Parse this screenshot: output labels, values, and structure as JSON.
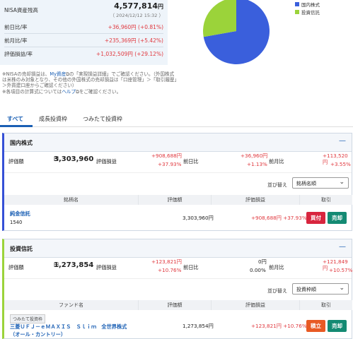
{
  "summary": {
    "nisa_label": "NISA資産残高",
    "nisa_value": "4,577,814",
    "nisa_unit": "円",
    "nisa_time": "（ 2024/12/12 15:32 ）",
    "rows": [
      {
        "label": "前日比/率",
        "value": "+36,960円 (+0.81%)"
      },
      {
        "label": "前月比/率",
        "value": "+235,369円 (+5.42%)"
      },
      {
        "label": "評価損益/率",
        "value": "+1,032,509円 (+29.12%)"
      }
    ]
  },
  "chart_data": {
    "type": "pie",
    "categories": [
      "国内株式",
      "投資信託"
    ],
    "values": [
      3303960,
      1273854
    ],
    "colors": [
      "#3a5fdc",
      "#9bd33a"
    ]
  },
  "notes": [
    "※NISAの売却損益は、",
    "My資産",
    "の「実現損益詳細」でご確認ください。",
    "（外国株式は米株のみ対象となり、その他の外国株式の売却損益は「口座管理」＞「取引履歴」＞外貨建口座からご確認ください）",
    "※各項目の計算式については",
    "ヘルプ",
    "をご確認ください。"
  ],
  "tabs": [
    "すべて",
    "成長投資枠",
    "つみたて投資枠"
  ],
  "domestic": {
    "title": "国内株式",
    "valuation_label": "評価額",
    "valuation": "3,303,960",
    "unit": "円",
    "pl_label": "評価損益",
    "pl_amount": "+908,688円",
    "pl_rate": "+37.93%",
    "day_label": "前日比",
    "day_amount": "+36,960円",
    "day_rate": "+1.13%",
    "month_label": "前月比",
    "month_amount": "+113,520円",
    "month_rate": "+3.55%",
    "sort_label": "並び替え",
    "sort_value": "銘柄名順",
    "cols": [
      "銘柄名",
      "評価額",
      "評価損益",
      "取引"
    ],
    "row": {
      "name": "純金信託",
      "code": "1540",
      "valuation": "3,303,960円",
      "pl": "+908,688円 +37.93%",
      "buy": "買付",
      "sell": "売却"
    }
  },
  "funds": {
    "title": "投資信託",
    "valuation_label": "評価額",
    "valuation": "1,273,854",
    "unit": "円",
    "pl_label": "評価損益",
    "pl_amount": "+123,821円",
    "pl_rate": "+10.76%",
    "day_label": "前日比",
    "day_amount": "0円",
    "day_rate": "0.00%",
    "month_label": "前月比",
    "month_amount": "+121,849円",
    "month_rate": "+10.57%",
    "sort_label": "並び替え",
    "sort_value": "投資枠順",
    "cols": [
      "ファンド名",
      "評価額",
      "評価損益",
      "取引"
    ],
    "row": {
      "badge": "つみたて投資枠",
      "name1": "三菱ＵＦＪ－ｅＭＡＸＩＳ　Ｓｌｉｍ　全世界株式",
      "name2": "（オール・カントリー）",
      "valuation": "1,273,854円",
      "pl": "+123,821円 +10.76%",
      "buy": "積立",
      "sell": "売却"
    }
  }
}
